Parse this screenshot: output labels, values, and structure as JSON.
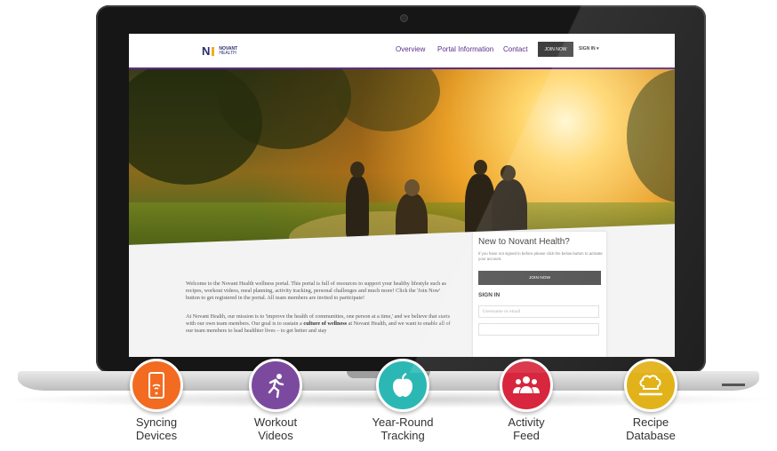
{
  "header": {
    "logo_mark": "N",
    "logo_line1": "NOVANT",
    "logo_line2": "HEALTH",
    "nav": [
      "Overview",
      "Portal Information",
      "Contact"
    ],
    "join_label": "JOIN NOW",
    "signin_label": "SIGN IN ▾"
  },
  "main": {
    "para1": "Welcome to the Novant Health wellness portal. This portal is full of resources to support your healthy lifestyle such as recipes, workout videos, meal planning, activity tracking, personal challenges and much more! Click the 'Join Now' button to get registered in the portal. All team members are invited to participate!",
    "para2_pre": "At Novant Health, our mission is to 'improve the health of communities, one person at a time,' and we believe that starts with our own team members. Our goal is to sustain a ",
    "para2_bold": "culture of wellness",
    "para2_post": " at Novant Health, and we want to enable all of our team members to lead healthier lives – to get better and stay"
  },
  "signup_card": {
    "title": "New to Novant Health?",
    "desc": "If you have not signed in before please click the below button to activate your account.",
    "join_label": "JOIN NOW",
    "signin_heading": "SIGN IN",
    "username_placeholder": "Username or email"
  },
  "features": [
    {
      "label": "Syncing Devices",
      "color": "#f26b21",
      "icon": "tablet-sync-icon"
    },
    {
      "label": "Workout Videos",
      "color": "#7b4a9e",
      "icon": "running-person-icon"
    },
    {
      "label": "Year-Round Tracking",
      "color": "#2bb8b5",
      "icon": "apple-icon"
    },
    {
      "label": "Activity Feed",
      "color": "#d7263d",
      "icon": "group-icon"
    },
    {
      "label": "Recipe Database",
      "color": "#e2b21b",
      "icon": "chef-hat-icon"
    }
  ]
}
